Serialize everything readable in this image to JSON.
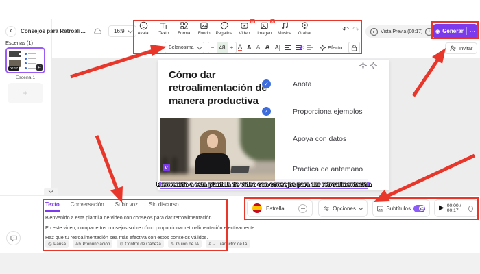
{
  "header": {
    "project_title": "Consejos para Retroalimen...",
    "aspect_ratio": "16:9",
    "vista_previa_label": "Vista Previa (00:17)",
    "generar_label": "Generar",
    "generar_more": "···",
    "invitar_label": "Invitar"
  },
  "toolbar": {
    "items": [
      {
        "label": "Avatar"
      },
      {
        "label": "Texto"
      },
      {
        "label": "Forma"
      },
      {
        "label": "Fondo"
      },
      {
        "label": "Pegatina"
      },
      {
        "label": "Video",
        "badge": "AI"
      },
      {
        "label": "Imagen",
        "badge": "AI"
      },
      {
        "label": "Música"
      },
      {
        "label": "Grabar"
      }
    ]
  },
  "format_bar": {
    "font_name": "Belanosima",
    "font_size": "48",
    "minus": "−",
    "plus": "+",
    "efecto_label": "Efecto"
  },
  "scenes_panel": {
    "header": "Escenas (1)",
    "scene_duration": "00:17",
    "scene_label": "Escena 1"
  },
  "canvas": {
    "slide_title": "Cómo dar retroalimentación de manera productiva",
    "checklist": [
      "Anota",
      "Proporciona ejemplos",
      "Apoya con datos",
      "Practica de antemano"
    ],
    "subtitle_overlay": "Bienvenido a esta plantilla de video con consejos para dar retroalimentación",
    "watermark": "V"
  },
  "script_panel": {
    "tabs": [
      "Texto",
      "Conversación",
      "Subir voz",
      "Sin discurso"
    ],
    "active_tab": "Texto",
    "lines": [
      "Bienvenido a esta plantilla de video con consejos para dar retroalimentación.",
      "En este video, comparte tus consejos sobre cómo proporcionar retroalimentación efectivamente.",
      "Haz que tu retroalimentación sea más efectiva con estos consejos válidos."
    ],
    "tags": [
      "Pausa",
      "Pronunciación",
      "Control de Cabeza",
      "Guión de IA",
      "Traductor de IA"
    ]
  },
  "voice_bar": {
    "voice_name": "Estrella",
    "opciones_label": "Opciones",
    "subtitulos_label": "Subtítulos",
    "time": "00:00 / 00:17"
  },
  "colors": {
    "accent_purple": "#7C3AED",
    "annotation_red": "#E8362A",
    "check_blue": "#3D6DDC",
    "toggle_purple": "#8B5CF6"
  }
}
